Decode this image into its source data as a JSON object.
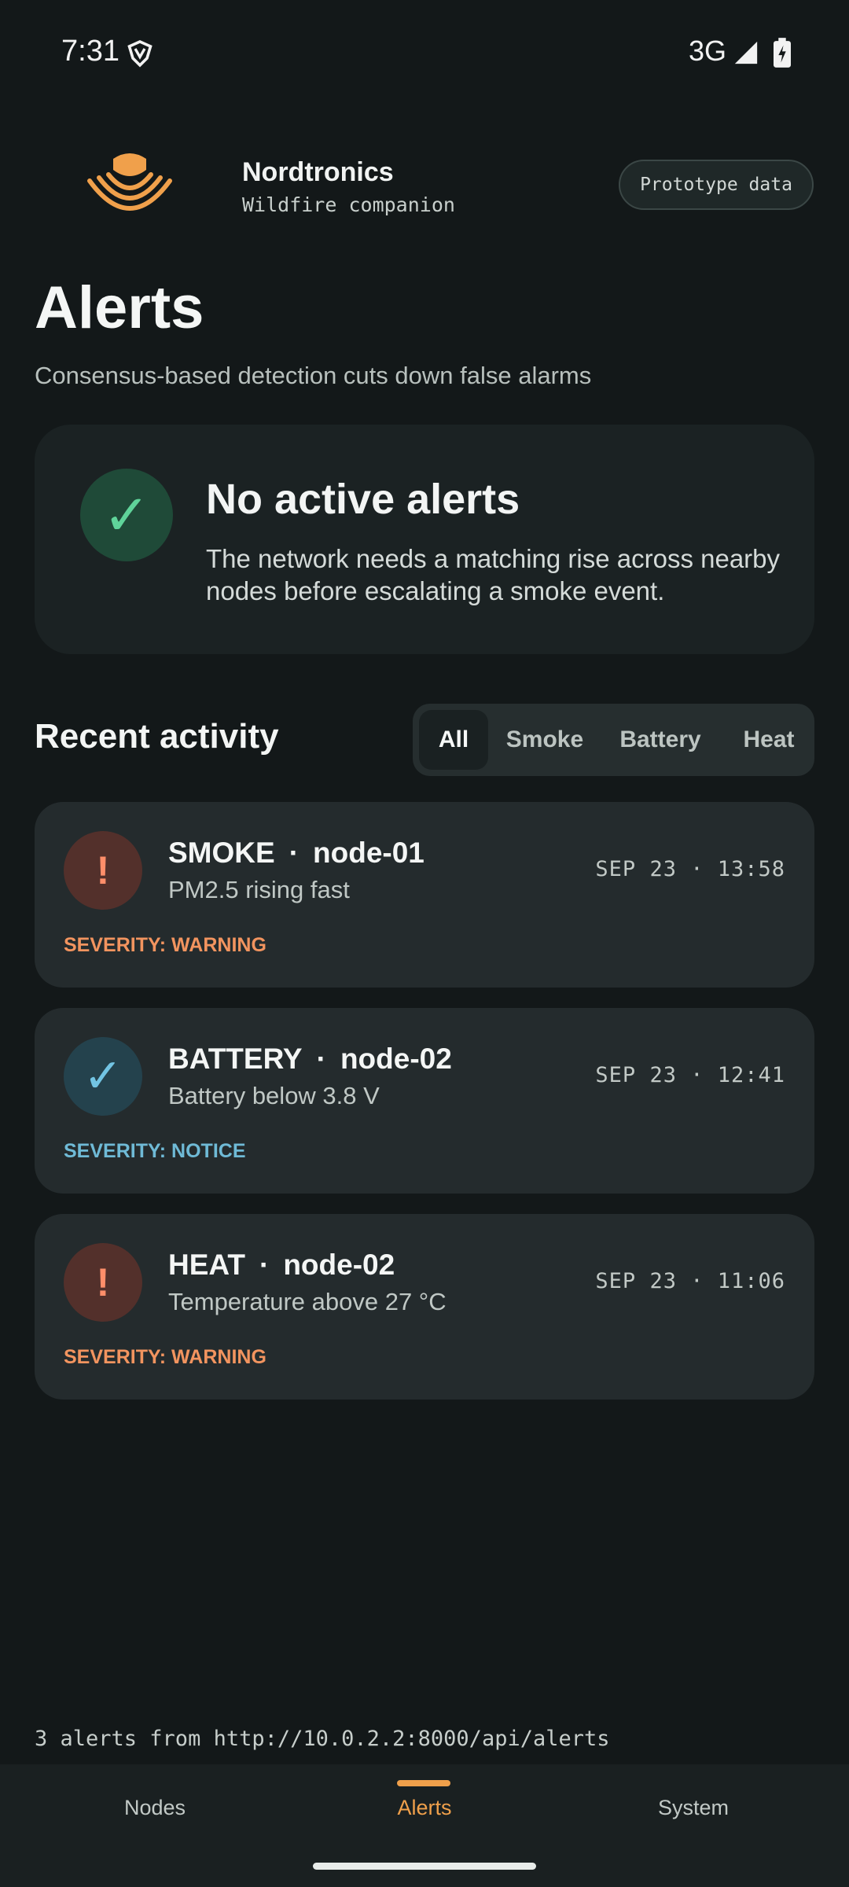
{
  "status_bar": {
    "time": "7:31",
    "network": "3G",
    "icons": [
      "vpn-icon",
      "signal-icon",
      "battery-charging-icon"
    ]
  },
  "header": {
    "brand_name": "Nordtronics",
    "brand_subtitle": "Wildfire companion",
    "chip_label": "Prototype data",
    "logo_color": "#f0a04b"
  },
  "page": {
    "title": "Alerts",
    "subtitle": "Consensus-based detection cuts down false alarms"
  },
  "status_card": {
    "title": "No active alerts",
    "description": "The network needs a matching rise across nearby nodes before escalating a smoke event.",
    "icon": "check-icon"
  },
  "activity": {
    "title": "Recent activity",
    "filters": [
      {
        "label": "All",
        "active": true
      },
      {
        "label": "Smoke",
        "active": false
      },
      {
        "label": "Battery",
        "active": false
      },
      {
        "label": "Heat",
        "active": false
      }
    ],
    "items": [
      {
        "type": "SMOKE",
        "separator": "·",
        "node": "node-01",
        "description": "PM2.5 rising fast",
        "time": "SEP 23 · 13:58",
        "severity": "SEVERITY: WARNING",
        "icon_glyph": "!"
      },
      {
        "type": "BATTERY",
        "separator": "·",
        "node": "node-02",
        "description": "Battery below 3.8 V",
        "time": "SEP 23 · 12:41",
        "severity": "SEVERITY: NOTICE",
        "icon_glyph": "✓"
      },
      {
        "type": "HEAT",
        "separator": "·",
        "node": "node-02",
        "description": "Temperature above 27 °C",
        "time": "SEP 23 · 11:06",
        "severity": "SEVERITY: WARNING",
        "icon_glyph": "!"
      }
    ]
  },
  "footer_note": "3 alerts from http://10.0.2.2:8000/api/alerts",
  "nav": {
    "items": [
      {
        "label": "Nodes",
        "active": false
      },
      {
        "label": "Alerts",
        "active": true
      },
      {
        "label": "System",
        "active": false
      }
    ]
  },
  "colors": {
    "background": "#131819",
    "accent": "#f0a04b",
    "warning": "#f2945f",
    "notice": "#6fbad6",
    "ok": "#5fd49a"
  }
}
